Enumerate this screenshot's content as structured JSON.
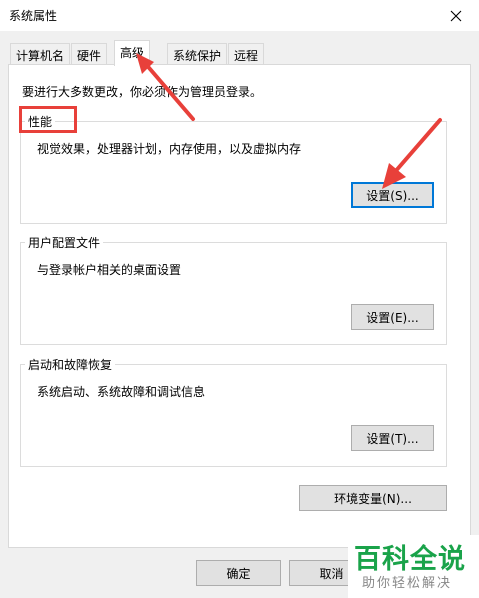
{
  "window": {
    "title": "系统属性"
  },
  "tabs": [
    "计算机名",
    "硬件",
    "高级",
    "系统保护",
    "远程"
  ],
  "active_tab": "高级",
  "admin_note": "要进行大多数更改，你必须作为管理员登录。",
  "performance": {
    "title": "性能",
    "description": "视觉效果，处理器计划，内存使用，以及虚拟内存",
    "button": "设置(S)..."
  },
  "user_profiles": {
    "title": "用户配置文件",
    "description": "与登录帐户相关的桌面设置",
    "button": "设置(E)..."
  },
  "startup_recovery": {
    "title": "启动和故障恢复",
    "description": "系统启动、系统故障和调试信息",
    "button": "设置(T)..."
  },
  "env_button": "环境变量(N)...",
  "footer": {
    "ok": "确定",
    "cancel": "取消"
  },
  "watermark": {
    "name": "百科全说",
    "slogan": "助你轻松解决"
  },
  "colors": {
    "annotation": "#e8403a",
    "focus": "#0078d7",
    "watermark": "#1aa34a"
  },
  "icons": {
    "close": "close-icon"
  }
}
